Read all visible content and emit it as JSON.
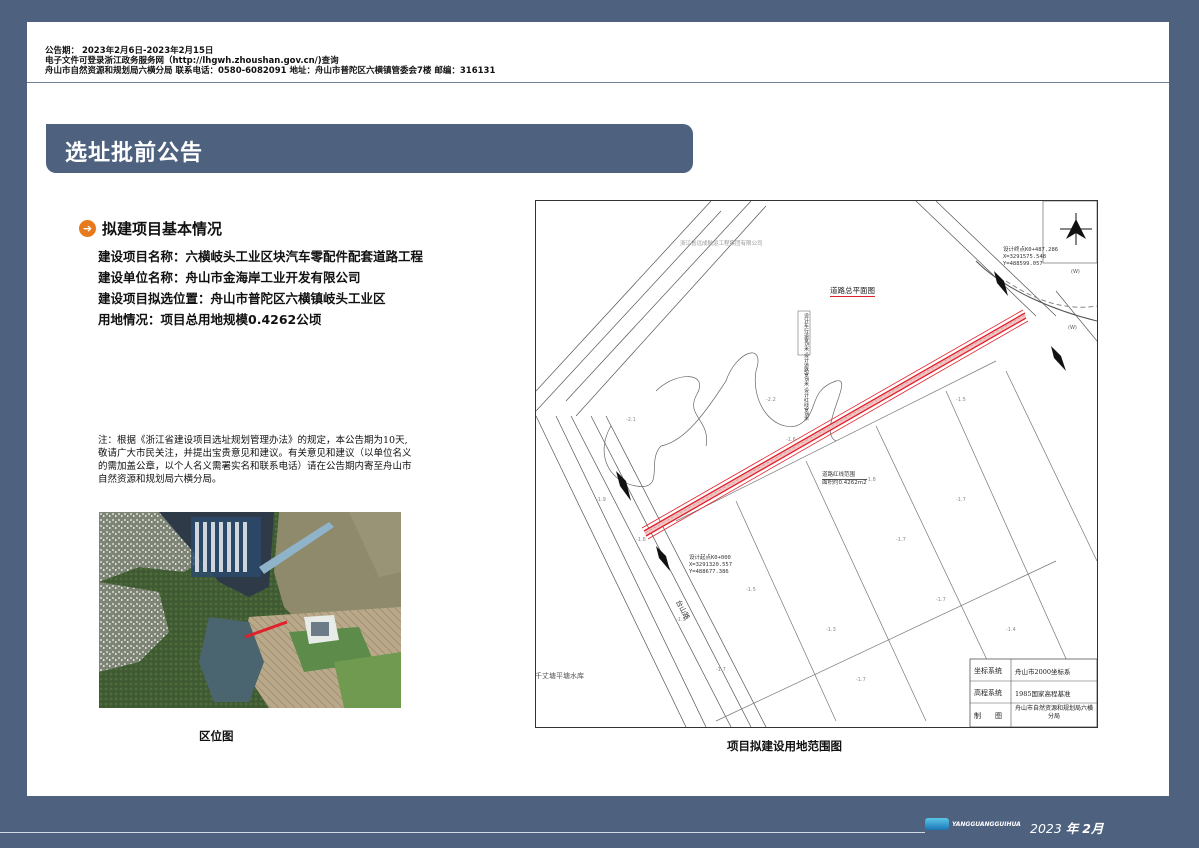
{
  "header": {
    "line1": "公告期：  2023年2月6日-2023年2月15日",
    "line2": "电子文件可登录浙江政务服务网（http://lhgwh.zhoushan.gov.cn/)查询",
    "line3": "舟山市自然资源和规划局六横分局    联系电话：0580-6082091    地址：舟山市普陀区六横镇管委会7楼    邮编：316131"
  },
  "banner": {
    "title": "选址批前公告"
  },
  "section": {
    "icon": "arrow-right-circle-icon",
    "title": "拟建项目基本情况"
  },
  "info": {
    "project_name": "建设项目名称：六横岐头工业区块汽车零配件配套道路工程",
    "unit_name": "建设单位名称：舟山市金海岸工业开发有限公司",
    "location": "建设项目拟选位置：舟山市普陀区六横镇岐头工业区",
    "land_use": "用地情况：项目总用地规模0.4262公顷"
  },
  "note": "注：根据《浙江省建设项目选址规划管理办法》的规定，本公告期为10天,敬请广大市民关注，并提出宝贵意见和建议。有关意见和建议（以单位名义的需加盖公章，以个人名义需署实名和联系电话）请在公告期内寄至舟山市自然资源和规划局六横分局。",
  "captions": {
    "left": "区位图",
    "right": "项目拟建设用地范围图"
  },
  "plan": {
    "title": "道路总平面图",
    "top_label": "浙江省远成航运工程集团有限公司",
    "end_point": [
      "设计终点K0+487.286",
      "X=3291575.548",
      "Y=488599.057"
    ],
    "start_point": [
      "设计起点K0+000",
      "X=3291320.557",
      "Y=488677.386"
    ],
    "red_line": [
      "道路红线范围",
      "面积约0.4262m2"
    ],
    "vertical_note": [
      "设计车行道宽5米",
      "设计道路宽8米",
      "设计红线宽8米"
    ],
    "road_name": "台山路",
    "bottom_left_label": "千丈塘平塘水库",
    "label_b1": "(W)",
    "label_b2": "(W)",
    "title_block": [
      {
        "label": "坐标系统",
        "value": "舟山市2000坐标系"
      },
      {
        "label": "高程系统",
        "value": "1985国家高程基准"
      },
      {
        "label": "制　　图",
        "value": "舟山市自然资源和规划局六横分局"
      }
    ]
  },
  "footer": {
    "logo_text": "YANGGUANGGUIHUA",
    "date_year": "2023",
    "date_sep": "年",
    "date_month": "2月"
  },
  "colors": {
    "frame": "#4e6280",
    "accent": "#e87a1e",
    "red_line": "#e0202a"
  }
}
